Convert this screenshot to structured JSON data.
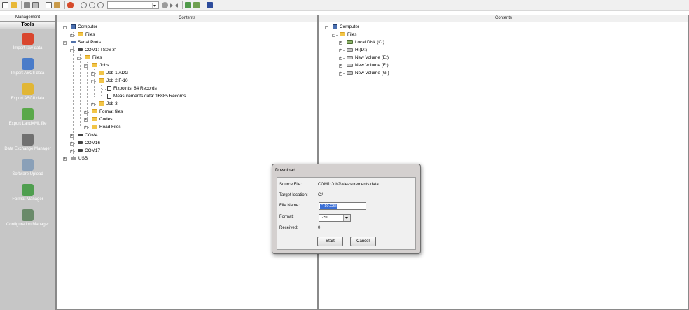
{
  "toolbar": {
    "icons": [
      "new-icon",
      "open-icon",
      "print-icon",
      "print-preview-icon",
      "copy-icon",
      "paste-icon",
      "connection-icon",
      "zoom-icon",
      "zoom-in-icon",
      "zoom-out-icon",
      "combo-box",
      "navigate-icon",
      "forward-icon",
      "back-icon",
      "tools-icon",
      "settings-icon",
      "help-icon"
    ],
    "combo_value": ""
  },
  "sidebar": {
    "header": "Management",
    "section": "Tools",
    "items": [
      {
        "label": "Import raw data",
        "icon": "import-raw-data-icon",
        "color": "#d9462e"
      },
      {
        "label": "Import ASCII data",
        "icon": "import-ascii-data-icon",
        "color": "#4a7cc9"
      },
      {
        "label": "Export ASCII data",
        "icon": "export-ascii-data-icon",
        "color": "#e1b635"
      },
      {
        "label": "Export LandXML file",
        "icon": "export-landxml-icon",
        "color": "#5aa84a"
      },
      {
        "label": "Data Exchange Manager",
        "icon": "data-exchange-manager-icon",
        "color": "#707070"
      },
      {
        "label": "Software Upload",
        "icon": "software-upload-icon",
        "color": "#8aa0b8"
      },
      {
        "label": "Format Manager",
        "icon": "format-manager-icon",
        "color": "#4f9e4f"
      },
      {
        "label": "Configuration Manager",
        "icon": "configuration-manager-icon",
        "color": "#6a8a6a"
      }
    ]
  },
  "left_pane": {
    "header": "Contents",
    "nodes": [
      {
        "label": "Computer",
        "icon": "computer-icon",
        "expander": "−"
      },
      {
        "label": "Files",
        "icon": "folder-icon",
        "expander": "+"
      },
      {
        "label": "Serial Ports",
        "icon": "serial-ports-icon",
        "expander": "−"
      },
      {
        "label": "COM1: TS06-3\"",
        "icon": "com-port-icon",
        "expander": "−"
      },
      {
        "label": "Files",
        "icon": "folder-icon",
        "expander": "−"
      },
      {
        "label": "Jobs",
        "icon": "folder-icon",
        "expander": "−"
      },
      {
        "label": "Job 1:ADG",
        "icon": "folder-icon",
        "expander": "+"
      },
      {
        "label": "Job 2:F-10",
        "icon": "folder-icon",
        "expander": "−"
      },
      {
        "label": "Fixpoints: 84 Records",
        "icon": "file-icon",
        "expander": ""
      },
      {
        "label": "Measurements data: 16885 Records",
        "icon": "file-icon",
        "expander": ""
      },
      {
        "label": "Job 3:-",
        "icon": "folder-icon",
        "expander": "+"
      },
      {
        "label": "Format files",
        "icon": "folder-icon",
        "expander": "+"
      },
      {
        "label": "Codes",
        "icon": "folder-icon",
        "expander": "+"
      },
      {
        "label": "Road Files",
        "icon": "folder-icon",
        "expander": "+"
      },
      {
        "label": "COM4",
        "icon": "com-port-icon",
        "expander": "+"
      },
      {
        "label": "COM16",
        "icon": "com-port-icon",
        "expander": "+"
      },
      {
        "label": "COM17",
        "icon": "com-port-icon",
        "expander": "+"
      },
      {
        "label": "USB",
        "icon": "usb-icon",
        "expander": "+"
      }
    ]
  },
  "right_pane": {
    "header": "Contents",
    "nodes": [
      {
        "label": "Computer",
        "icon": "computer-icon",
        "expander": "−"
      },
      {
        "label": "Files",
        "icon": "folder-icon",
        "expander": "−"
      },
      {
        "label": "Local Disk (C:)",
        "icon": "local-disk-icon",
        "expander": "+"
      },
      {
        "label": "H (D:)",
        "icon": "drive-icon",
        "expander": "+"
      },
      {
        "label": "New Volume (E:)",
        "icon": "drive-icon",
        "expander": "+"
      },
      {
        "label": "New Volume (F:)",
        "icon": "drive-icon",
        "expander": "+"
      },
      {
        "label": "New Volume (G:)",
        "icon": "drive-icon",
        "expander": "+"
      }
    ]
  },
  "dialog": {
    "title": "Download",
    "source_label": "Source File:",
    "source_value": "COM1:Job2\\Measurements data",
    "target_label": "Target location:",
    "target_value": "C:\\",
    "filename_label": "File Name:",
    "filename_value": "F-10.GSI",
    "format_label": "Format:",
    "format_value": "GSI",
    "received_label": "Received:",
    "received_value": "0",
    "start_label": "Start",
    "cancel_label": "Cancel"
  }
}
